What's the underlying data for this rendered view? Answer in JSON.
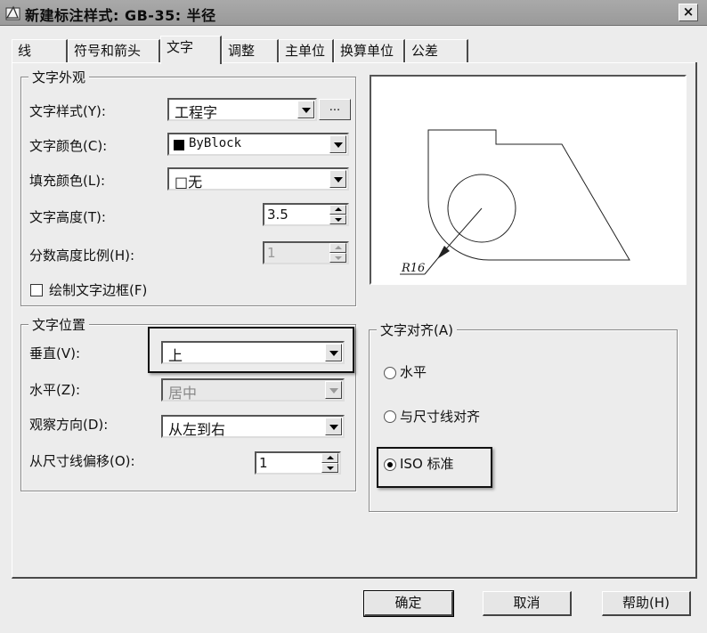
{
  "window": {
    "title": "新建标注样式: GB-35: 半径",
    "close_glyph": "×"
  },
  "tabs": [
    "线",
    "符号和箭头",
    "文字",
    "调整",
    "主单位",
    "换算单位",
    "公差"
  ],
  "text_appearance": {
    "title": "文字外观",
    "style_label": "文字样式(Y):",
    "style_value": "工程字",
    "style_browse": "...",
    "color_label": "文字颜色(C):",
    "color_value": "ByBlock",
    "fill_label": "填充颜色(L):",
    "fill_value": "□无",
    "height_label": "文字高度(T):",
    "height_value": "3.5",
    "fraction_label": "分数高度比例(H):",
    "fraction_value": "1",
    "frame_label": "绘制文字边框(F)"
  },
  "text_placement": {
    "title": "文字位置",
    "vertical_label": "垂直(V):",
    "vertical_value": "上",
    "horizontal_label": "水平(Z):",
    "horizontal_value": "居中",
    "view_label": "观察方向(D):",
    "view_value": "从左到右",
    "offset_label": "从尺寸线偏移(O):",
    "offset_value": "1"
  },
  "preview": {
    "dim_text": "R16"
  },
  "text_alignment": {
    "title": "文字对齐(A)",
    "options": [
      "水平",
      "与尺寸线对齐",
      "ISO 标准"
    ],
    "selected": 2
  },
  "buttons": {
    "ok": "确定",
    "cancel": "取消",
    "help": "帮助(H)"
  }
}
